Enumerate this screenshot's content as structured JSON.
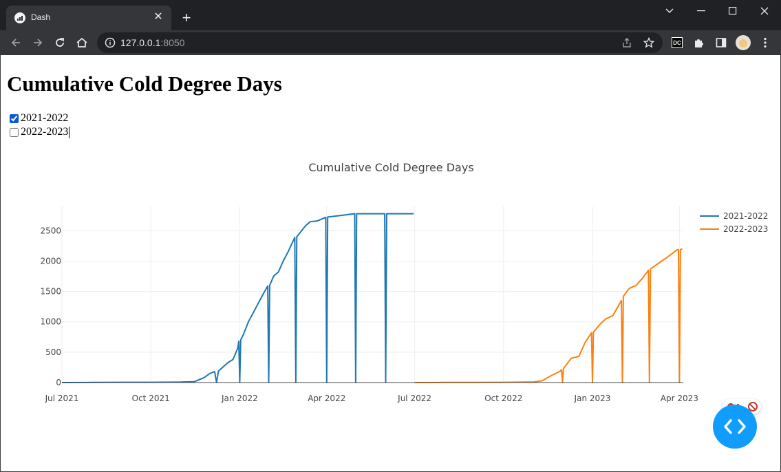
{
  "browser": {
    "tab_title": "Dash",
    "url_host": "127.0.0.1",
    "url_port": ":8050"
  },
  "page": {
    "title": "Cumulative Cold Degree Days",
    "checklist": [
      {
        "label": "2021-2022",
        "checked": true
      },
      {
        "label": "2022-2023",
        "checked": false
      }
    ]
  },
  "chart_data": {
    "type": "line",
    "title": "Cumulative Cold Degree Days",
    "xlabel": "",
    "ylabel": "",
    "x_range": [
      "2021-07-01",
      "2023-04-05"
    ],
    "y_range": [
      0,
      2900
    ],
    "x_ticks": [
      {
        "date": "2021-07-01",
        "label": "Jul 2021"
      },
      {
        "date": "2021-10-01",
        "label": "Oct 2021"
      },
      {
        "date": "2022-01-01",
        "label": "Jan 2022"
      },
      {
        "date": "2022-04-01",
        "label": "Apr 2022"
      },
      {
        "date": "2022-07-01",
        "label": "Jul 2022"
      },
      {
        "date": "2022-10-01",
        "label": "Oct 2022"
      },
      {
        "date": "2023-01-01",
        "label": "Jan 2023"
      },
      {
        "date": "2023-04-01",
        "label": "Apr 2023"
      }
    ],
    "y_ticks": [
      0,
      500,
      1000,
      1500,
      2000,
      2500
    ],
    "grid": true,
    "legend": "top-right",
    "series": [
      {
        "name": "2021-2022",
        "color": "#1f77b4",
        "points": [
          [
            "2021-07-01",
            0
          ],
          [
            "2021-08-01",
            2
          ],
          [
            "2021-09-01",
            4
          ],
          [
            "2021-10-01",
            5
          ],
          [
            "2021-11-01",
            8
          ],
          [
            "2021-11-15",
            15
          ],
          [
            "2021-11-25",
            80
          ],
          [
            "2021-12-01",
            150
          ],
          [
            "2021-12-06",
            180
          ],
          [
            "2021-12-08",
            0
          ],
          [
            "2021-12-10",
            190
          ],
          [
            "2021-12-15",
            260
          ],
          [
            "2021-12-20",
            330
          ],
          [
            "2021-12-25",
            380
          ],
          [
            "2021-12-30",
            570
          ],
          [
            "2021-12-31",
            680
          ],
          [
            "2022-01-01",
            0
          ],
          [
            "2022-01-02",
            700
          ],
          [
            "2022-01-05",
            800
          ],
          [
            "2022-01-10",
            1000
          ],
          [
            "2022-01-15",
            1150
          ],
          [
            "2022-01-20",
            1300
          ],
          [
            "2022-01-25",
            1450
          ],
          [
            "2022-01-30",
            1590
          ],
          [
            "2022-01-31",
            0
          ],
          [
            "2022-02-01",
            1600
          ],
          [
            "2022-02-05",
            1750
          ],
          [
            "2022-02-10",
            1820
          ],
          [
            "2022-02-15",
            2000
          ],
          [
            "2022-02-20",
            2150
          ],
          [
            "2022-02-27",
            2390
          ],
          [
            "2022-02-28",
            0
          ],
          [
            "2022-03-01",
            2400
          ],
          [
            "2022-03-05",
            2480
          ],
          [
            "2022-03-10",
            2580
          ],
          [
            "2022-03-15",
            2650
          ],
          [
            "2022-03-22",
            2660
          ],
          [
            "2022-03-31",
            2720
          ],
          [
            "2022-04-01",
            0
          ],
          [
            "2022-04-02",
            2725
          ],
          [
            "2022-04-10",
            2740
          ],
          [
            "2022-04-20",
            2760
          ],
          [
            "2022-04-30",
            2780
          ],
          [
            "2022-05-01",
            0
          ],
          [
            "2022-05-02",
            2780
          ],
          [
            "2022-05-31",
            2780
          ],
          [
            "2022-06-01",
            0
          ],
          [
            "2022-06-02",
            2780
          ],
          [
            "2022-06-30",
            2780
          ]
        ]
      },
      {
        "name": "2022-2023",
        "color": "#ff7f0e",
        "points": [
          [
            "2022-07-01",
            0
          ],
          [
            "2022-08-01",
            2
          ],
          [
            "2022-09-01",
            3
          ],
          [
            "2022-10-01",
            5
          ],
          [
            "2022-11-01",
            10
          ],
          [
            "2022-11-10",
            30
          ],
          [
            "2022-11-20",
            120
          ],
          [
            "2022-11-28",
            180
          ],
          [
            "2022-11-30",
            210
          ],
          [
            "2022-12-01",
            0
          ],
          [
            "2022-12-02",
            230
          ],
          [
            "2022-12-10",
            400
          ],
          [
            "2022-12-18",
            430
          ],
          [
            "2022-12-24",
            650
          ],
          [
            "2022-12-31",
            820
          ],
          [
            "2023-01-01",
            0
          ],
          [
            "2023-01-02",
            830
          ],
          [
            "2023-01-10",
            980
          ],
          [
            "2023-01-15",
            1050
          ],
          [
            "2023-01-22",
            1100
          ],
          [
            "2023-01-31",
            1350
          ],
          [
            "2023-02-01",
            0
          ],
          [
            "2023-02-02",
            1420
          ],
          [
            "2023-02-08",
            1550
          ],
          [
            "2023-02-15",
            1600
          ],
          [
            "2023-02-22",
            1720
          ],
          [
            "2023-02-28",
            1850
          ],
          [
            "2023-03-01",
            0
          ],
          [
            "2023-03-02",
            1870
          ],
          [
            "2023-03-10",
            1960
          ],
          [
            "2023-03-20",
            2070
          ],
          [
            "2023-03-30",
            2190
          ],
          [
            "2023-03-31",
            2190
          ],
          [
            "2023-04-01",
            0
          ],
          [
            "2023-04-02",
            2190
          ],
          [
            "2023-04-04",
            2200
          ]
        ]
      }
    ]
  }
}
